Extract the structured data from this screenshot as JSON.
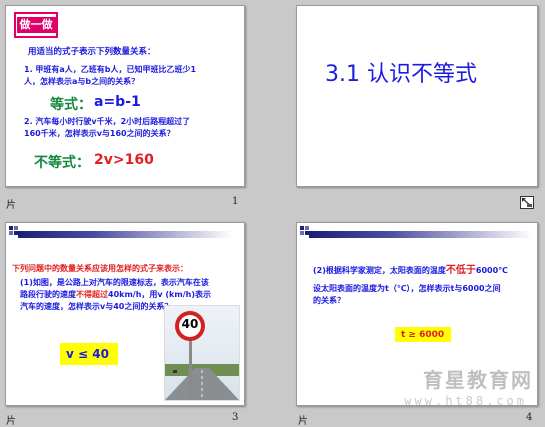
{
  "slides": [
    {
      "pane_label": "片",
      "number": "1",
      "tag": "做一做",
      "intro": "用适当的式子表示下列数量关系：",
      "q1_line1": "1. 甲班有a人，乙班有b人，已知甲班比乙班少1",
      "q1_line2": "人，怎样表示a与b之间的关系？",
      "eq_label": "等式：",
      "eq_value": "a=b-1",
      "q2_line1": "2. 汽车每小时行驶v千米，2小时后路程超过了",
      "q2_line2": "160千米，怎样表示v与160之间的关系？",
      "ineq_label": "不等式：",
      "ineq_value": "2v>160"
    },
    {
      "title": "3.1 认识不等式"
    },
    {
      "pane_label": "片",
      "number": "3",
      "heading": "下列问题中的数量关系应该用怎样的式子来表示：",
      "p_line1": "(1)如图，是公路上对汽车的限速标志，表示汽车在该",
      "p_line2a": "路段行驶的速度",
      "p_line2_red": "不得超过",
      "p_line2b": "40km/h，用v (km/h)表示",
      "p_line3": "汽车的速度，怎样表示v与40之间的关系？",
      "answer": "v ≤ 40",
      "sign_text": "40"
    },
    {
      "pane_label": "片",
      "number": "4",
      "p_line1a": "(2)根据科学家测定，太阳表面的温度",
      "p_line1_red": "不低于",
      "p_line1b": "6000℃",
      "p_line2": "设太阳表面的温度为t（℃），怎样表示t与6000之间",
      "p_line3": "的关系？",
      "answer": "t ≥ 6000"
    }
  ],
  "watermark": {
    "text": "育星教育网",
    "url": "www.ht88.com"
  },
  "colors": {
    "blue": "#1a1ae0",
    "red": "#e02020",
    "green": "#138a3c",
    "magenta": "#e0006a",
    "highlight": "#ffff00"
  },
  "icons": [
    "slide-transition-icon"
  ]
}
